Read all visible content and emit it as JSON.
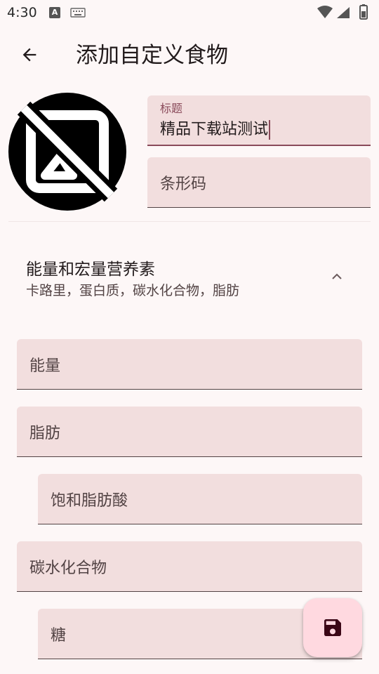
{
  "status_bar": {
    "time": "4:30",
    "notification_icon": "a-letter-icon",
    "keyboard_icon": "keyboard-icon",
    "wifi_icon": "wifi-icon",
    "signal_icon": "signal-icon",
    "battery_icon": "battery-icon"
  },
  "app_bar": {
    "back_icon": "arrow-back-icon",
    "title": "添加自定义食物"
  },
  "image_placeholder": {
    "icon": "hide-image-icon"
  },
  "fields": {
    "title": {
      "label": "标题",
      "value": "精品下载站测试"
    },
    "barcode": {
      "placeholder": "条形码"
    }
  },
  "section": {
    "title": "能量和宏量营养素",
    "subtitle": "卡路里，蛋白质，碳水化合物，脂肪",
    "expanded": true,
    "chevron_icon": "chevron-up-icon"
  },
  "nutrient_fields": [
    {
      "placeholder": "能量",
      "indent": false
    },
    {
      "placeholder": "脂肪",
      "indent": false
    },
    {
      "placeholder": "饱和脂肪酸",
      "indent": true
    },
    {
      "placeholder": "碳水化合物",
      "indent": false
    },
    {
      "placeholder": "糖",
      "indent": true
    }
  ],
  "fab": {
    "icon": "save-icon"
  },
  "colors": {
    "background": "#fdf7f7",
    "field_fill": "#f2dede",
    "accent": "#8a4a5a",
    "fab": "#ffd9e0"
  }
}
